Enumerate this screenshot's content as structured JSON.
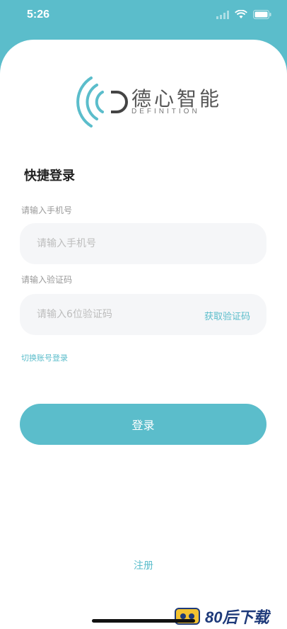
{
  "status_bar": {
    "time": "5:26"
  },
  "brand": {
    "name": "德心智能",
    "subtitle": "DEFINITION",
    "color": "#5BBDCB"
  },
  "login": {
    "heading": "快捷登录",
    "phone_label": "请输入手机号",
    "phone_placeholder": "请输入手机号",
    "code_label": "请输入验证码",
    "code_placeholder": "请输入6位验证码",
    "get_code": "获取验证码",
    "switch_account": "切换账号登录",
    "submit": "登录",
    "register": "注册"
  },
  "watermark": {
    "text": "80后下载"
  }
}
